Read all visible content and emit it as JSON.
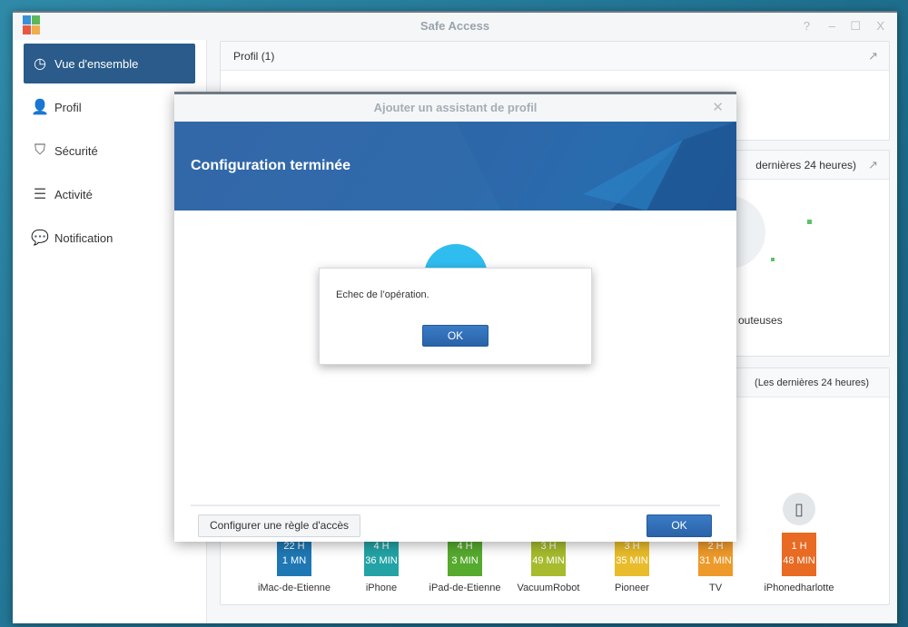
{
  "window": {
    "title": "Safe Access",
    "controls": [
      "?",
      "–",
      "☐",
      "X"
    ]
  },
  "sidebar": {
    "items": [
      {
        "label": "Vue d'ensemble",
        "icon": "gauge-icon",
        "active": true
      },
      {
        "label": "Profil",
        "icon": "user-icon"
      },
      {
        "label": "Sécurité",
        "icon": "shield-icon"
      },
      {
        "label": "Activité",
        "icon": "list-icon"
      },
      {
        "label": "Notification",
        "icon": "chat-icon"
      }
    ]
  },
  "panels": {
    "profil": {
      "title": "Profil",
      "count": "(1)"
    },
    "security": {
      "title_partial": "dernières 24 heures)",
      "legend_partial": "outeuses"
    },
    "activity": {
      "title_partial": "(Les dernières 24 heures)"
    }
  },
  "devices": [
    {
      "name": "iMac-de-Etienne",
      "h": "22 H",
      "m": "1 MN",
      "color": "#1f78b4"
    },
    {
      "name": "iPhone",
      "h": "4 H",
      "m": "36 MIN",
      "color": "#23a3a5"
    },
    {
      "name": "iPad-de-Etienne",
      "h": "4 H",
      "m": "3 MIN",
      "color": "#56aa2e"
    },
    {
      "name": "VacuumRobot",
      "h": "3 H",
      "m": "49 MIN",
      "color": "#a7bb2d"
    },
    {
      "name": "Pioneer",
      "h": "3 H",
      "m": "35 MIN",
      "color": "#e9bc2b"
    },
    {
      "name": "TV",
      "h": "2 H",
      "m": "31 MIN",
      "color": "#ee9a2a"
    },
    {
      "name": "iPhonedharlotte",
      "h": "1 H",
      "m": "48 MIN",
      "color": "#e86a23"
    }
  ],
  "dialog": {
    "title": "Ajouter un assistant de profil",
    "banner": "Configuration terminée",
    "configure_button": "Configurer une règle d'accès",
    "ok_button": "OK"
  },
  "alert": {
    "message": "Echec de l’opération.",
    "ok_button": "OK"
  }
}
